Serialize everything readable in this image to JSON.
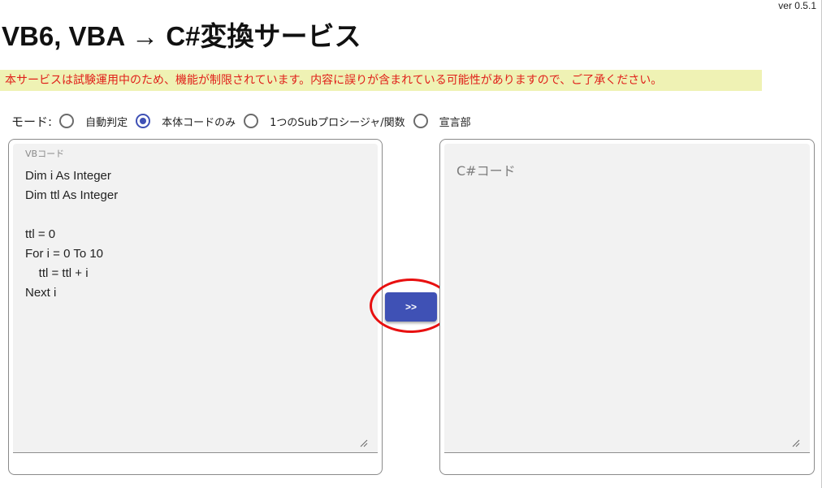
{
  "version": "ver 0.5.1",
  "title": "VB6, VBA → C#変換サービス",
  "notice": "本サービスは試験運用中のため、機能が制限されています。内容に誤りが含まれている可能性がありますので、ご了承ください。",
  "mode": {
    "label": "モード:",
    "options": [
      {
        "label": "自動判定",
        "selected": false
      },
      {
        "label": "本体コードのみ",
        "selected": true
      },
      {
        "label": "1つのSubプロシージャ/関数",
        "selected": false
      },
      {
        "label": "宣言部",
        "selected": false
      }
    ]
  },
  "input_panel": {
    "label": "VBコード",
    "value": "Dim i As Integer\nDim ttl As Integer\n\nttl = 0\nFor i = 0 To 10\n    ttl = ttl + i\nNext i"
  },
  "convert_button": {
    "label": ">>"
  },
  "output_panel": {
    "placeholder": "C#コード",
    "value": ""
  },
  "colors": {
    "accent": "#3f51b5",
    "notice_background": "#eff2b4",
    "notice_text": "#e0201a",
    "highlight_ring": "#e81010"
  }
}
